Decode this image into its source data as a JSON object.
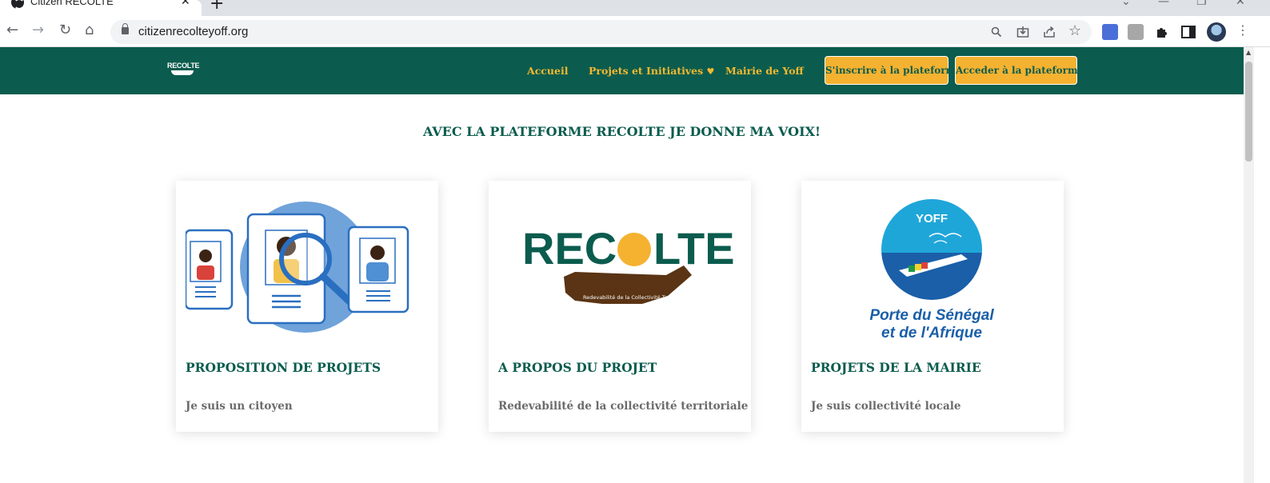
{
  "browser": {
    "tab_title": "Citizen RECOLTE",
    "tab_close": "✕",
    "new_tab": "+",
    "url": "citizenrecolteyoff.org",
    "nav": {
      "back": "←",
      "forward": "→",
      "reload": "↻",
      "home": "⌂"
    },
    "window_controls": {
      "dropdown": "⌄",
      "minimize": "—",
      "maximize": "❐",
      "close": "✕"
    },
    "icons": {
      "zoom": "search-icon",
      "install": "install-icon",
      "share": "share-icon",
      "bookmark": "☆",
      "extensions": "puzzle-icon",
      "sidepanel": "sidepanel-icon",
      "menu": "⋮"
    }
  },
  "site": {
    "colors": {
      "primary": "#0b5c4e",
      "accent": "#f5b230",
      "muted_text": "#6b6b6b"
    },
    "brand": {
      "text": "RECOLTE"
    },
    "nav": {
      "links": [
        {
          "label": "Accueil"
        },
        {
          "label": "Projets et Initiatives",
          "icon": "heart-icon"
        },
        {
          "label": "Mairie de Yoff"
        }
      ],
      "buttons": [
        {
          "label": "S'inscrire à la plateforme"
        },
        {
          "label": "Acceder à la plateforme"
        }
      ]
    },
    "headline": "AVEC LA PLATEFORME RECOLTE JE DONNE MA VOIX!",
    "cards": [
      {
        "title": "PROPOSITION DE PROJETS",
        "subtitle": "Je suis un citoyen",
        "image": "citizen-profiles-illustration"
      },
      {
        "title": "A PROPOS DU PROJET",
        "subtitle": "Redevabilité de la collectivité territoriale",
        "image": "recolte-logo",
        "logo": {
          "word_left": "REC",
          "word_right": "LTE",
          "tagline": "Redevabilité de la Collectivité Territoriale"
        }
      },
      {
        "title": "PROJETS DE LA MAIRIE",
        "subtitle": "Je suis collectivité locale",
        "image": "yoff-logo",
        "logo": {
          "badge": "YOFF",
          "line1": "Porte du Sénégal",
          "line2": "et de l'Afrique"
        }
      }
    ]
  }
}
